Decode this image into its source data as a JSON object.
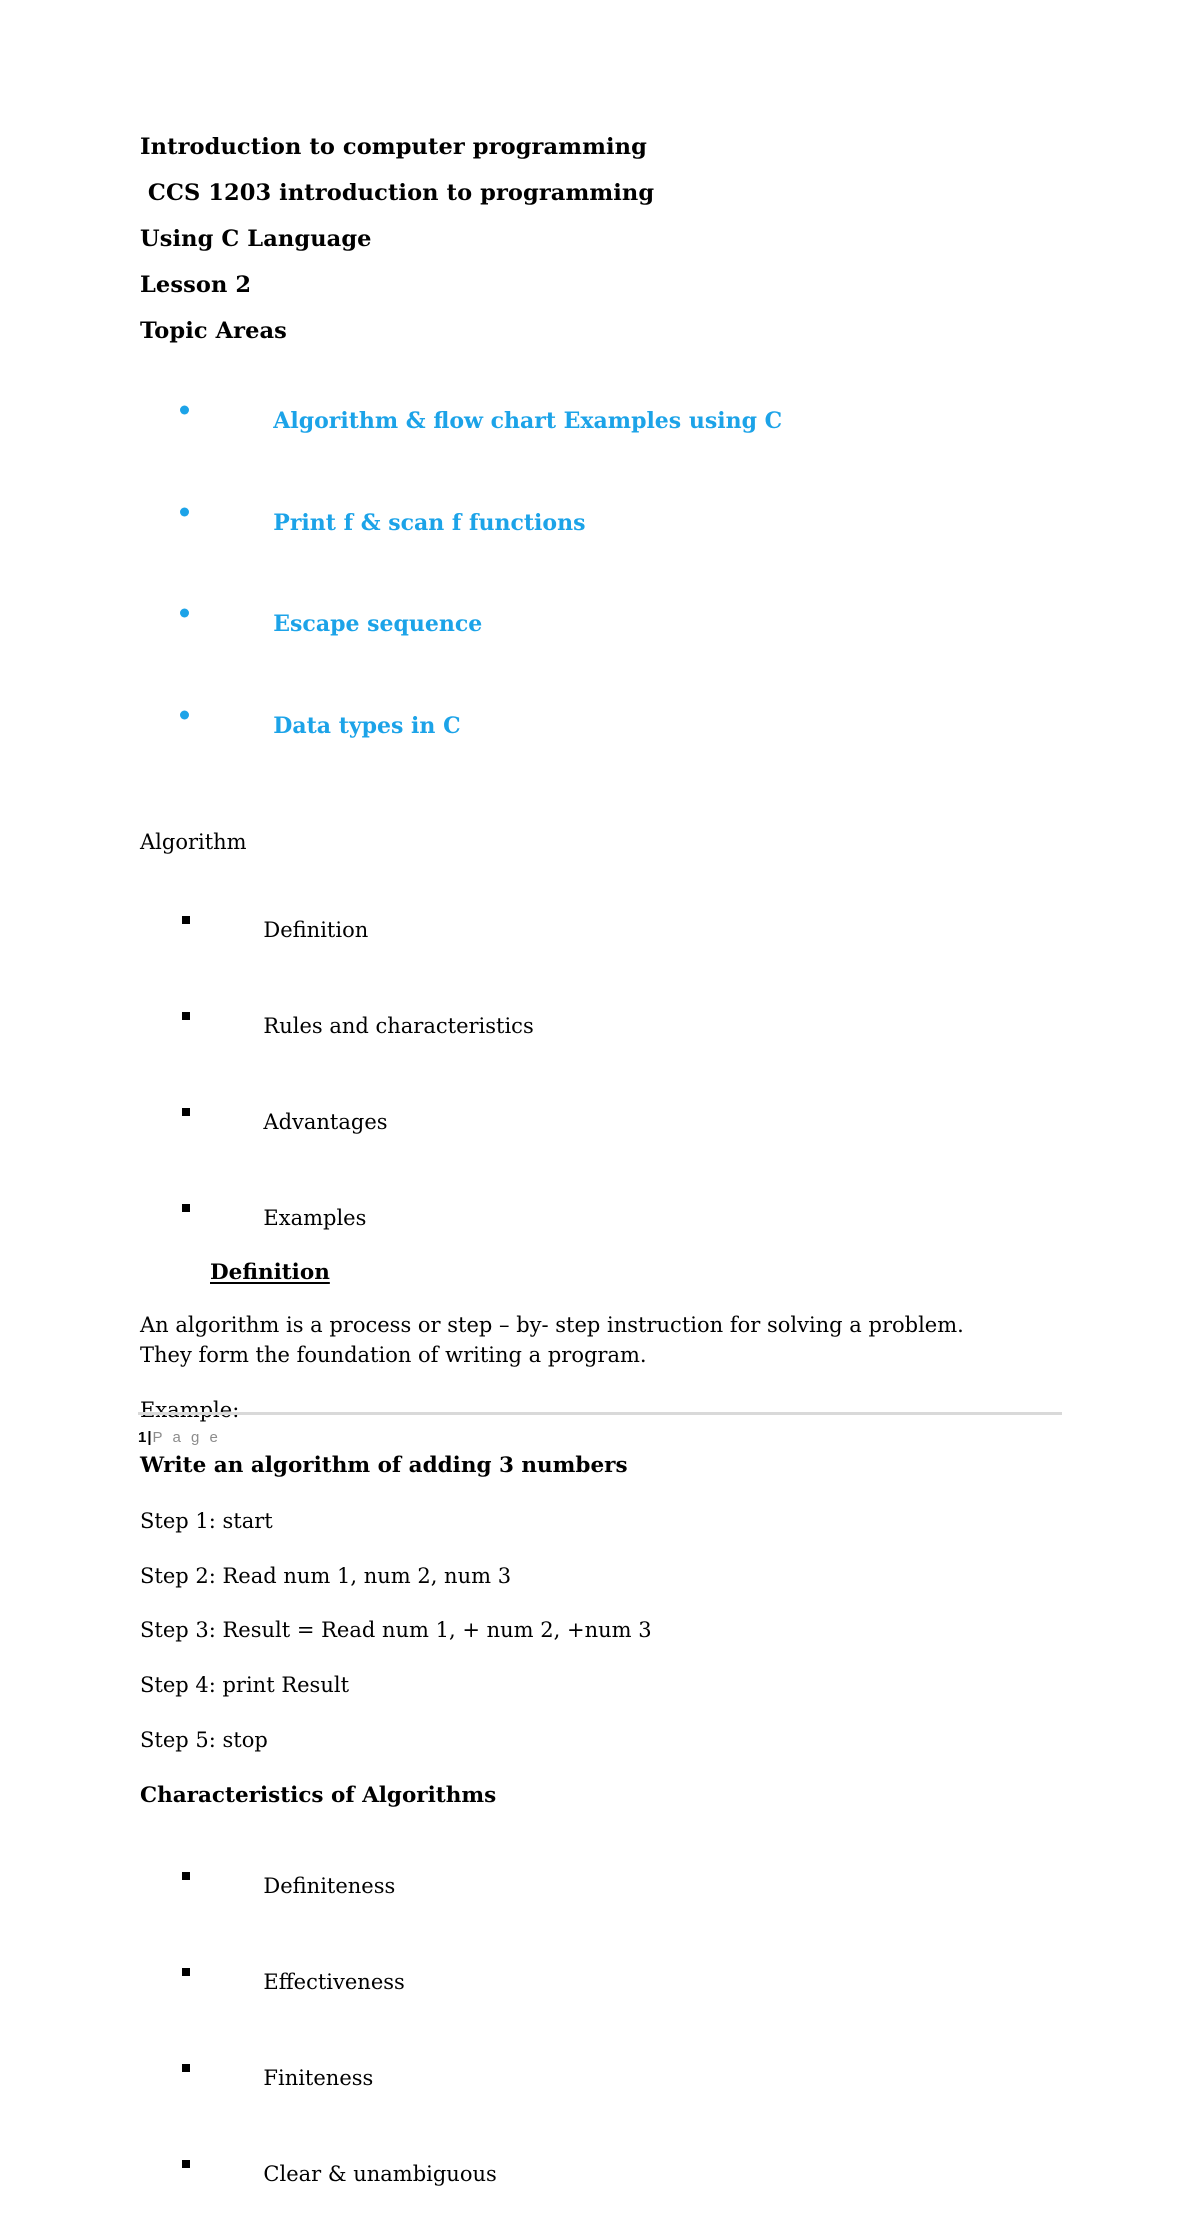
{
  "document": {
    "headings": [
      "Introduction to computer programming",
      " CCS 1203 introduction to programming",
      "Using C Language",
      "Lesson 2",
      "Topic Areas"
    ],
    "topic_list": {
      "accent_color": "#1CA3E8",
      "items": [
        "Algorithm & flow chart Examples using C",
        "Print f & scan f functions",
        "Escape sequence",
        "Data types in C"
      ]
    },
    "algorithm_section": {
      "title": "Algorithm",
      "items": [
        "Definition",
        "Rules and characteristics",
        "Advantages",
        "Examples"
      ],
      "subheading": "Definition",
      "definition_paragraph": "An algorithm is a process or step – by- step instruction for solving a problem. They form the foundation of writing a program.",
      "example_label": "Example:",
      "example_title": "Write an algorithm of adding 3 numbers",
      "steps": [
        "Step 1: start",
        "Step 2: Read num 1, num 2, num 3",
        "Step 3: Result = Read num 1, + num 2, +num 3",
        "Step 4: print Result",
        "Step 5: stop"
      ]
    },
    "characteristics_section": {
      "title": "Characteristics of Algorithms",
      "items": [
        "Definiteness",
        "Effectiveness",
        "Finiteness",
        "Clear & unambiguous"
      ]
    },
    "footer": {
      "page_number": "1",
      "separator": "|",
      "page_word": "P a g e"
    }
  }
}
